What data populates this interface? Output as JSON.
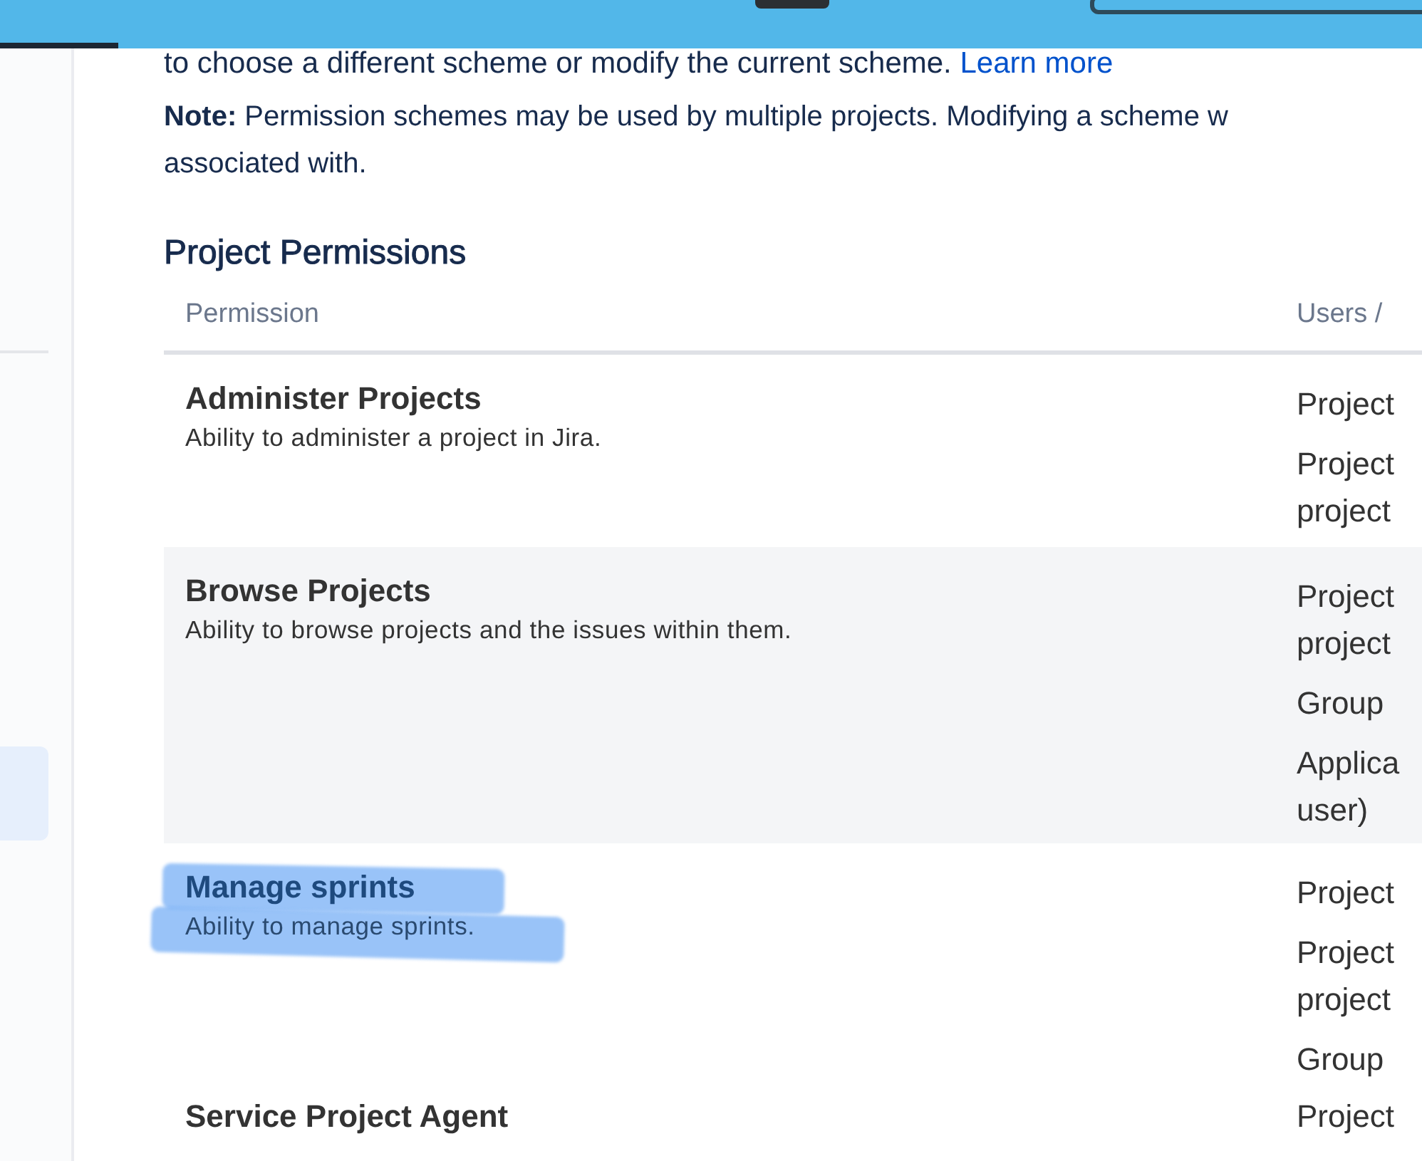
{
  "top_bar": {
    "tabs": [
      {
        "selected": true
      }
    ]
  },
  "intro": {
    "text": "to choose a different scheme or modify the current scheme.",
    "link": "Learn more"
  },
  "note": [
    "**Note:** Permission schemes may be used by multiple projects. Modifying a scheme w",
    "associated with."
  ],
  "sidebar": {
    "items": [
      {
        "selected": false
      },
      {
        "selected": true
      }
    ]
  },
  "section_title": "Project Permissions",
  "table": {
    "columns": [
      "Permission",
      "Users / "
    ],
    "rows": [
      {
        "name": "Administer Projects",
        "description": "Ability to administer a project in Jira.",
        "highlighted": false,
        "users": [
          [
            "Project"
          ],
          [
            "Project",
            "project"
          ]
        ]
      },
      {
        "name": "Browse Projects",
        "description": "Ability to browse projects and the issues within them.",
        "highlighted": false,
        "users": [
          [
            "Project",
            "project"
          ],
          [
            "Group"
          ],
          [
            "Applica",
            "user)"
          ]
        ]
      },
      {
        "name": "Manage sprints",
        "description": "Ability to manage sprints.",
        "highlighted": true,
        "users": [
          [
            "Project"
          ],
          [
            "Project",
            "project"
          ],
          [
            "Group"
          ]
        ]
      },
      {
        "name": "Service Project Agent",
        "highlighted": false,
        "users": [
          [
            "Project"
          ]
        ]
      }
    ]
  }
}
